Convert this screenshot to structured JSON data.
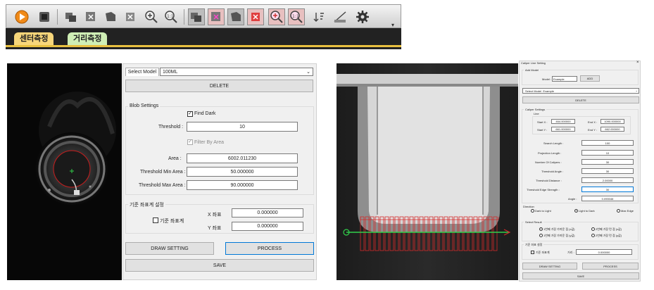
{
  "colors": {
    "accent": "#0078d7",
    "tab_active": "#f7d67a",
    "tab_inactive": "#cfeeb5",
    "circle": "#c81e1e",
    "caliper": "#d22a2a",
    "line": "#31d04b"
  },
  "toolbar": {
    "icons": [
      "run-icon",
      "stop-icon",
      "grab-icon",
      "clear-image-icon",
      "save-image-icon",
      "delete-icon",
      "zoom-in-icon",
      "zoom-reset-icon",
      "grab-icon-2",
      "clear-image-icon-2",
      "save-image-icon-2",
      "delete-icon-2",
      "zoom-in-icon-2",
      "zoom-reset-icon-2",
      "sort-icon",
      "ruler-icon",
      "gear-icon"
    ]
  },
  "tabs": [
    {
      "label": "센터측정"
    },
    {
      "label": "거리측정"
    }
  ],
  "left": {
    "select_model_tab": "Select Model",
    "model_value": "100ML",
    "delete": "DELETE",
    "blob": {
      "title": "Blob Settings",
      "find_dark": "Find Dark",
      "threshold_label": "Threshold :",
      "threshold": "10",
      "filter_by_area": "Filter By Area",
      "area_label": "Area :",
      "area": "6002.011230",
      "min_label": "Threshold Min Area :",
      "min": "50.000000",
      "max_label": "Threshold Max Area :",
      "max": "90.000000"
    },
    "ref": {
      "title": "기준 좌표계 설정",
      "check": "기준 좌표계",
      "x_label": "X 좌표",
      "x": "0.000000",
      "y_label": "Y 좌표",
      "y": "0.000000"
    },
    "draw_setting": "DRAW SETTING",
    "process": "PROCESS",
    "save": "SAVE"
  },
  "right": {
    "window_title": "Caliper Line Setting",
    "add_model": {
      "title": "Add Model",
      "model_label": "Model :",
      "model": "Example",
      "add": "ADD"
    },
    "select_model_label": "Select Model",
    "select_model_value": "Example",
    "delete": "DELETE",
    "caliper": {
      "title": "Caliper Settings",
      "line": "Line",
      "start_x_label": "Start X :",
      "start_x": "464.000000",
      "end_x_label": "End X :",
      "end_x": "1090.000000",
      "start_y_label": "Start Y :",
      "start_y": "661.000000",
      "end_y_label": "End Y :",
      "end_y": "662.000000",
      "rows": [
        {
          "label": "Search Length :",
          "value": "100"
        },
        {
          "label": "Projection Length :",
          "value": "10"
        },
        {
          "label": "Number Of Calipers :",
          "value": "30"
        },
        {
          "label": "Threshold Angle :",
          "value": "30"
        },
        {
          "label": "Threshold Distance :",
          "value": "2.00000"
        },
        {
          "label": "Threshold Edge Strength :",
          "value": "30"
        }
      ],
      "angle_label": "Angle :",
      "angle": "0.090046"
    },
    "direction": {
      "title": "Direction",
      "options": [
        "Dark to Light",
        "Light to Dark",
        "Max Edge"
      ],
      "selected": "Light to Dark"
    },
    "result": {
      "title": "Select Result",
      "options": [
        "1번째 가장 가까운 점 (x값)",
        "2번째 가장 먼 점 (x값)",
        "1번째 가장 가까운 점 (y값)",
        "2번째 가장 먼 점 (y값)"
      ]
    },
    "ref": {
      "title": "기준 좌표 설정",
      "check": "기준 좌표계",
      "dist_label": "거리 :",
      "dist": "0.000000"
    },
    "draw_setting": "DRAW SETTING",
    "process": "PROCESS",
    "save": "SAVE"
  }
}
